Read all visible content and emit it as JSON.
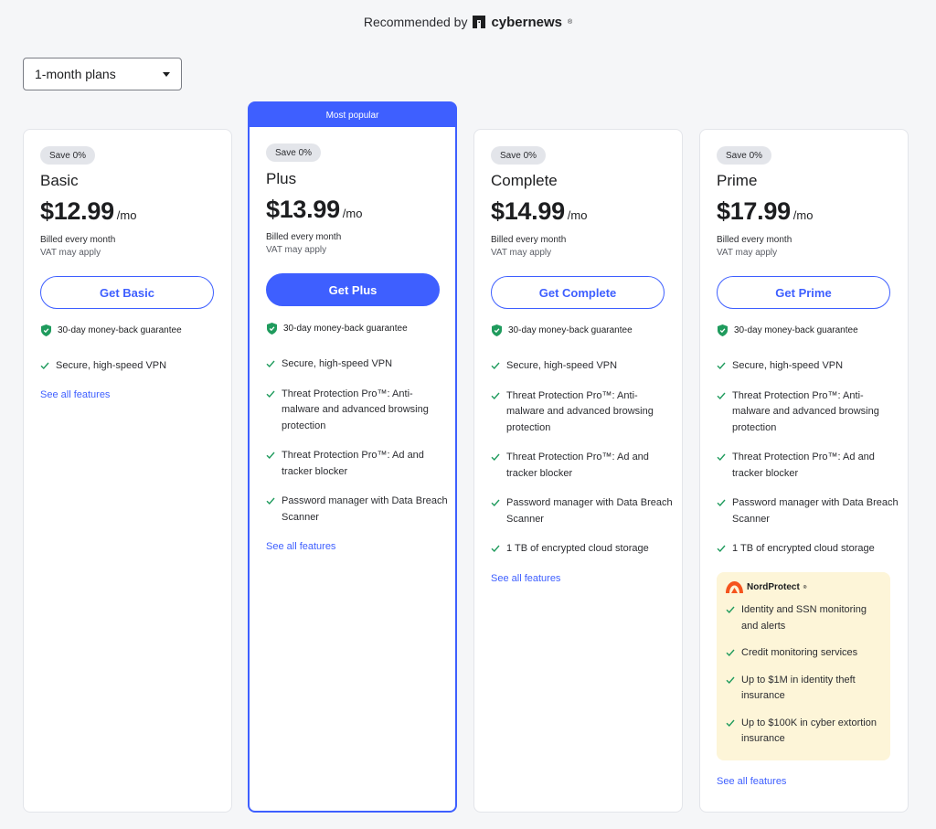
{
  "header": {
    "recommended_label": "Recommended by",
    "brand_name": "cybernews",
    "brand_mark": "®"
  },
  "plan_selector": {
    "value": "1-month plans"
  },
  "popular_banner": "Most popular",
  "common": {
    "guarantee": "30-day money-back guarantee",
    "billed": "Billed every month",
    "vat": "VAT may apply",
    "per_month": "/mo",
    "see_all": "See all features"
  },
  "plans": [
    {
      "badge": "Save 0%",
      "name": "Basic",
      "price": "$12.99",
      "cta": "Get Basic",
      "features": [
        "Secure, high-speed VPN"
      ]
    },
    {
      "badge": "Save 0%",
      "name": "Plus",
      "price": "$13.99",
      "cta": "Get Plus",
      "features": [
        "Secure, high-speed VPN",
        "Threat Protection Pro™: Anti-malware and advanced browsing protection",
        "Threat Protection Pro™: Ad and tracker blocker",
        "Password manager with Data Breach Scanner"
      ]
    },
    {
      "badge": "Save 0%",
      "name": "Complete",
      "price": "$14.99",
      "cta": "Get Complete",
      "features": [
        "Secure, high-speed VPN",
        "Threat Protection Pro™: Anti-malware and advanced browsing protection",
        "Threat Protection Pro™: Ad and tracker blocker",
        "Password manager with Data Breach Scanner",
        "1 TB of encrypted cloud storage"
      ]
    },
    {
      "badge": "Save 0%",
      "name": "Prime",
      "price": "$17.99",
      "cta": "Get Prime",
      "features": [
        "Secure, high-speed VPN",
        "Threat Protection Pro™: Anti-malware and advanced browsing protection",
        "Threat Protection Pro™: Ad and tracker blocker",
        "Password manager with Data Breach Scanner",
        "1 TB of encrypted cloud storage"
      ],
      "nordprotect": {
        "brand": "NordProtect",
        "brand_mark": "®",
        "features": [
          "Identity and SSN monitoring and alerts",
          "Credit monitoring services",
          "Up to $1M in identity theft insurance",
          "Up to $100K in cyber extortion insurance"
        ]
      }
    }
  ],
  "colors": {
    "accent": "#3e5fff",
    "check": "#1f9b5d",
    "nordprotect_bg": "#fdf5d8",
    "badge_bg": "#e3e5ea"
  }
}
